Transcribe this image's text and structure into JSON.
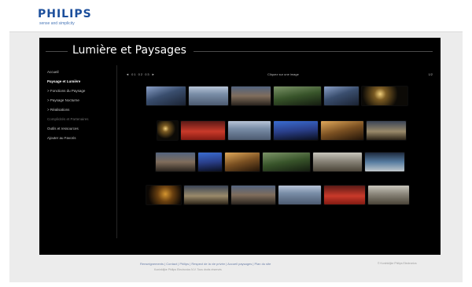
{
  "brand": {
    "name": "PHILIPS",
    "tagline": "sense and simplicity"
  },
  "page": {
    "title": "Lumière et Paysages"
  },
  "sidebar": {
    "items": [
      {
        "label": "Accueil",
        "state": "normal"
      },
      {
        "label": "Paysage et Lumière",
        "state": "active"
      },
      {
        "label": "> Fonctions du Paysage",
        "state": "normal"
      },
      {
        "label": "> Paysage Nocturne",
        "state": "normal"
      },
      {
        "label": "> Réalisations",
        "state": "normal"
      },
      {
        "label": "Complicités et Partenaires",
        "state": "dim"
      },
      {
        "label": "Outils et ressources",
        "state": "normal"
      },
      {
        "label": "Ajouter au Favoris",
        "state": "normal"
      }
    ]
  },
  "toolbar": {
    "pager": "◄ 01 02 03 ►",
    "center_text": "Cliquez sur une image",
    "right_text": "1/2"
  },
  "gallery": {
    "rows": [
      {
        "thumbs": [
          "night-blue",
          "sky-light",
          "dusk",
          "green",
          "night-blue",
          "sparkle"
        ]
      },
      {
        "thumbs": [
          "sparkle",
          "red",
          "sky-light",
          "blue-cobalt",
          "amber",
          "street"
        ]
      },
      {
        "thumbs": [
          "dusk",
          "blue-cobalt",
          "amber",
          "green",
          "pale-stone",
          "fountain"
        ]
      },
      {
        "thumbs": [
          "dark-amber",
          "street",
          "dusk",
          "sky-light",
          "red",
          "pale-stone"
        ]
      }
    ]
  },
  "footer": {
    "links": "Renseignements | Contact | Philips | Respect de la vie privée | Accueil paysages | Plan du site",
    "sub": "Koninklijke Philips Electronics N.V. Tous droits réservés",
    "right": "© Koninklijke Philips Electronics"
  },
  "colors": {
    "brand": "#1c4f9c",
    "stage_bg": "#000000",
    "panel_bg": "#ececec"
  }
}
